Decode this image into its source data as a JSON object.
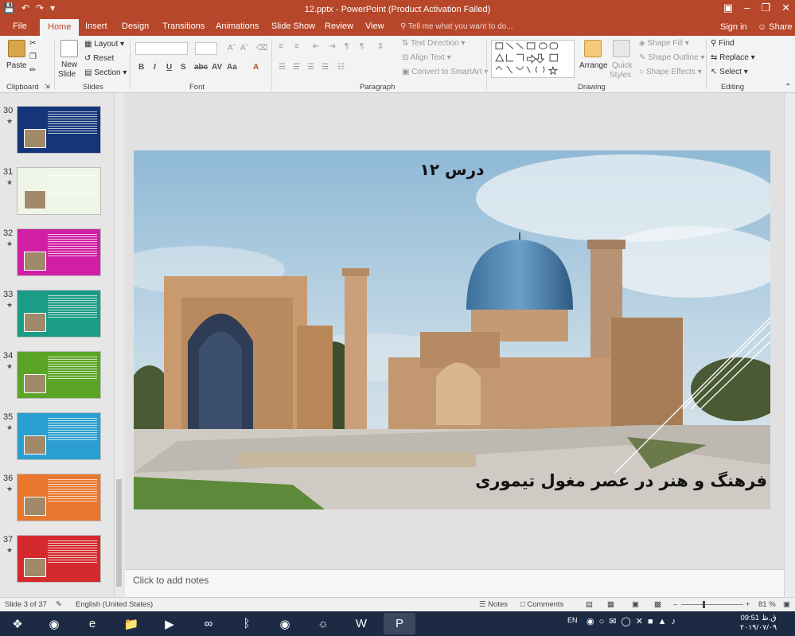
{
  "titlebar": {
    "title": "12.pptx - PowerPoint (Product Activation Failed)",
    "qat_save_icon": "save-icon",
    "qat_undo_icon": "undo-icon",
    "qat_redo_icon": "redo-icon",
    "qat_customize_icon": "customize-icon"
  },
  "tabs": {
    "file": "File",
    "home": "Home",
    "insert": "Insert",
    "design": "Design",
    "transitions": "Transitions",
    "animations": "Animations",
    "slideshow": "Slide Show",
    "review": "Review",
    "view": "View",
    "tellme": "Tell me what you want to do...",
    "signin": "Sign in",
    "share": "Share"
  },
  "ribbon": {
    "clipboard": {
      "paste": "Paste",
      "label": "Clipboard"
    },
    "slides": {
      "new_slide_1": "New",
      "new_slide_2": "Slide",
      "layout": "Layout",
      "reset": "Reset",
      "section": "Section",
      "label": "Slides"
    },
    "font": {
      "label": "Font"
    },
    "paragraph": {
      "text_direction": "Text Direction",
      "align_text": "Align Text",
      "convert_smartart": "Convert to SmartArt",
      "label": "Paragraph"
    },
    "drawing": {
      "arrange": "Arrange",
      "quick_styles_1": "Quick",
      "quick_styles_2": "Styles",
      "shape_fill": "Shape Fill",
      "shape_outline": "Shape Outline",
      "shape_effects": "Shape Effects",
      "label": "Drawing"
    },
    "editing": {
      "find": "Find",
      "replace": "Replace",
      "select": "Select",
      "label": "Editing"
    }
  },
  "thumbnails": [
    {
      "num": "30",
      "star": "★",
      "bg": "#14357a"
    },
    {
      "num": "31",
      "star": "★",
      "bg": "#eef5e6"
    },
    {
      "num": "32",
      "star": "★",
      "bg": "#d11fa5"
    },
    {
      "num": "33",
      "star": "★",
      "bg": "#1a9c86"
    },
    {
      "num": "34",
      "star": "★",
      "bg": "#5aa525"
    },
    {
      "num": "35",
      "star": "★",
      "bg": "#2a9fd0"
    },
    {
      "num": "36",
      "star": "★",
      "bg": "#e8772e"
    },
    {
      "num": "37",
      "star": "★",
      "bg": "#d42a2e"
    }
  ],
  "slide": {
    "title": "درس ۱۲",
    "subtitle": "فرهنگ و هنر در عصر مغول  تیموری"
  },
  "notes": {
    "placeholder": "Click to add notes"
  },
  "status": {
    "slide_info": "Slide 3 of 37",
    "language": "English (United States)",
    "notes": "Notes",
    "comments": "Comments",
    "zoom": "81 %"
  },
  "taskbar": {
    "lang": "EN",
    "time": "09:51 ق.ظ",
    "date": "۲۰۱۹/۰۷/۰۹"
  }
}
